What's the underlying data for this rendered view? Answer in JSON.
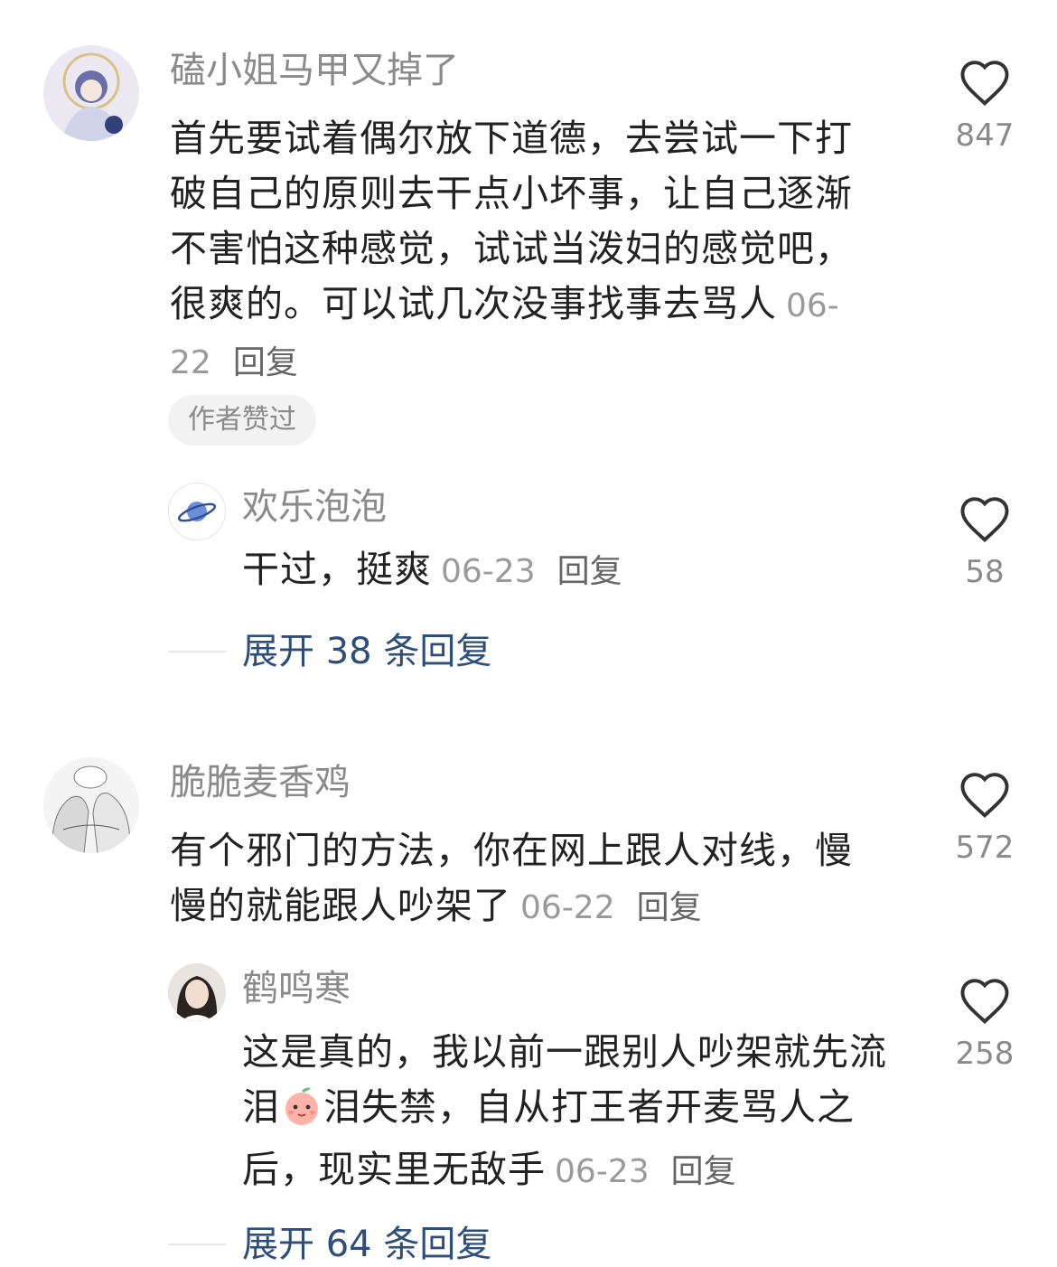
{
  "comments": [
    {
      "username": "磕小姐马甲又掉了",
      "text": "首先要试着偶尔放下道德，去尝试一下打破自己的原则去干点小坏事，让自己逐渐不害怕这种感觉，试试当泼妇的感觉吧，很爽的。可以试几次没事找事去骂人",
      "date": "06-22",
      "reply_label": "回复",
      "badge": "作者赞过",
      "likes": "847",
      "avatar_icon": "anime-character-avatar",
      "sub_reply": {
        "username": "欢乐泡泡",
        "text": "干过，挺爽",
        "date": "06-23",
        "reply_label": "回复",
        "likes": "58",
        "avatar_icon": "planet-avatar"
      },
      "expand_label": "展开 38 条回复"
    },
    {
      "username": "脆脆麦香鸡",
      "text": "有个邪门的方法，你在网上跟人对线，慢慢的就能跟人吵架了",
      "date": "06-22",
      "reply_label": "回复",
      "likes": "572",
      "avatar_icon": "manga-avatar",
      "sub_reply": {
        "username": "鹤鸣寒",
        "text_before_emoji": "这是真的，我以前一跟别人吵架就先流泪",
        "emoji_icon": "peach-face-emoji",
        "text_after_emoji": "泪失禁，自从打王者开麦骂人之后，现实里无敌手",
        "date": "06-23",
        "reply_label": "回复",
        "likes": "258",
        "avatar_icon": "girl-photo-avatar"
      },
      "expand_label": "展开 64 条回复"
    }
  ],
  "colors": {
    "username": "#8a8a8a",
    "body_text": "#222222",
    "expand_link": "#2d4d7a",
    "badge_bg": "#f2f2f2"
  }
}
